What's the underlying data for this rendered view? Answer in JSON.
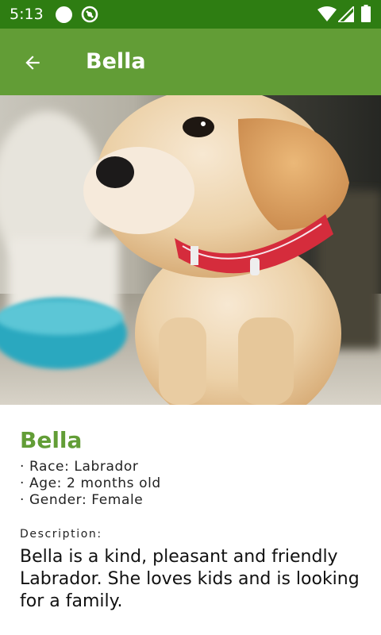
{
  "status_bar": {
    "time": "5:13",
    "icons": [
      "notification-dot-icon",
      "sync-icon",
      "wifi-icon",
      "signal-icon",
      "battery-icon"
    ]
  },
  "app_bar": {
    "back_icon": "arrow-back-icon",
    "title": "Bella"
  },
  "colors": {
    "status_bar": "#2e7d12",
    "app_bar": "#629d36",
    "accent": "#629d36"
  },
  "pet": {
    "name": "Bella",
    "attributes": [
      "· Race: Labrador",
      "· Age: 2 months old",
      "· Gender: Female"
    ],
    "description_label": "Description:",
    "description": "Bella is a kind, pleasant and friendly Labrador. She loves kids and is looking for a family."
  }
}
